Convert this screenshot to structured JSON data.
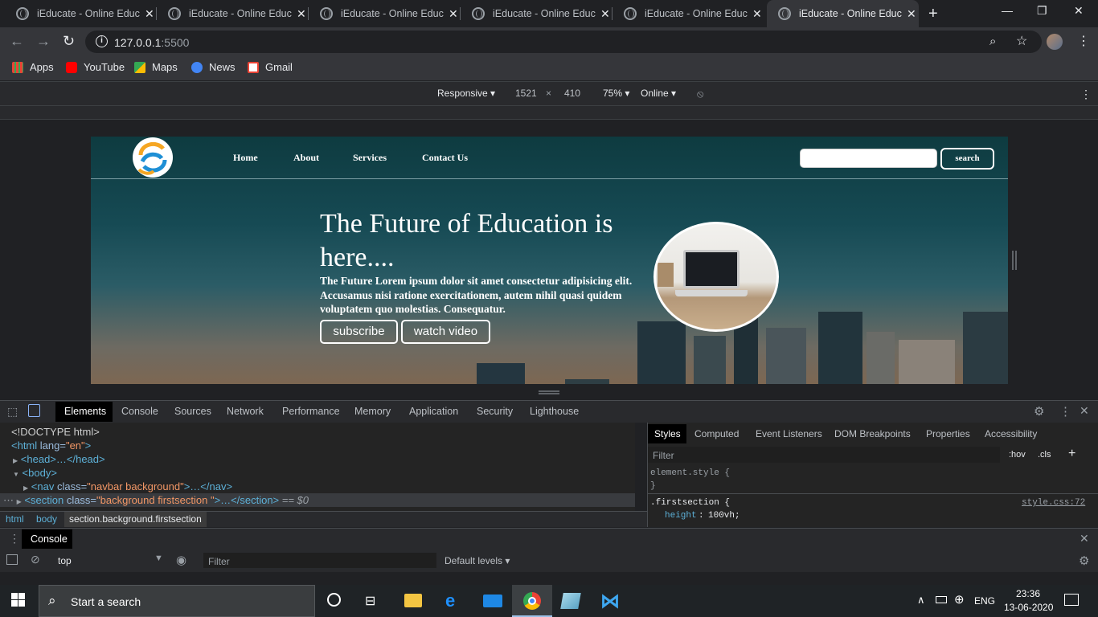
{
  "browser": {
    "tabs": [
      {
        "title": "iEducate - Online Educa"
      },
      {
        "title": "iEducate - Online Educa"
      },
      {
        "title": "iEducate - Online Educa"
      },
      {
        "title": "iEducate - Online Educa"
      },
      {
        "title": "iEducate - Online Educa"
      },
      {
        "title": "iEducate - Online Educa"
      }
    ],
    "url_host": "127.0.0.1",
    "url_port": ":5500",
    "bookmarks": [
      "Apps",
      "YouTube",
      "Maps",
      "News",
      "Gmail"
    ]
  },
  "device_toolbar": {
    "mode": "Responsive",
    "width": "1521",
    "times": "×",
    "height": "410",
    "zoom": "75%",
    "throttle": "Online"
  },
  "site": {
    "nav": [
      "Home",
      "About",
      "Services",
      "Contact Us"
    ],
    "search_button": "search",
    "hero_title": "The Future of Education is here....",
    "hero_text": "The Future Lorem ipsum dolor sit amet consectetur adipisicing elit. Accusamus nisi ratione exercitationem, autem nihil quasi quidem voluptatem quo molestias. Consequatur.",
    "subscribe": "subscribe",
    "watch_video": "watch video"
  },
  "devtools": {
    "tabs": [
      "Elements",
      "Console",
      "Sources",
      "Network",
      "Performance",
      "Memory",
      "Application",
      "Security",
      "Lighthouse"
    ],
    "dom": {
      "doctype": "<!DOCTYPE html>",
      "html_open": "<html",
      "html_attr": " lang=",
      "html_val": "\"en\"",
      "html_close": ">",
      "head": "<head>…</head>",
      "body": "<body>",
      "nav_open": "<nav",
      "nav_attr": " class=",
      "nav_val": "\"navbar background\"",
      "nav_close": ">…</nav>",
      "section_open": "<section",
      "section_attr": " class=",
      "section_val": "\"background firstsection \"",
      "section_close": ">…</section>",
      "section_marker": " == $0"
    },
    "breadcrumbs": [
      "html",
      "body",
      "section.background.firstsection"
    ],
    "styles_tabs": [
      "Styles",
      "Computed",
      "Event Listeners",
      "DOM Breakpoints",
      "Properties",
      "Accessibility"
    ],
    "styles_filter": "Filter",
    "hov": ":hov",
    "cls": ".cls",
    "element_style": "element.style {",
    "close_brace": "}",
    "rule_selector": ".firstsection {",
    "rule_source": "style.css:72",
    "rule_prop": "height",
    "rule_value": "100vh;",
    "drawer_tab": "Console",
    "console_context": "top",
    "console_filter": "Filter",
    "default_levels": "Default levels"
  },
  "taskbar": {
    "search": "Start a search",
    "lang": "ENG",
    "time": "23:36",
    "date": "13-06-2020"
  }
}
